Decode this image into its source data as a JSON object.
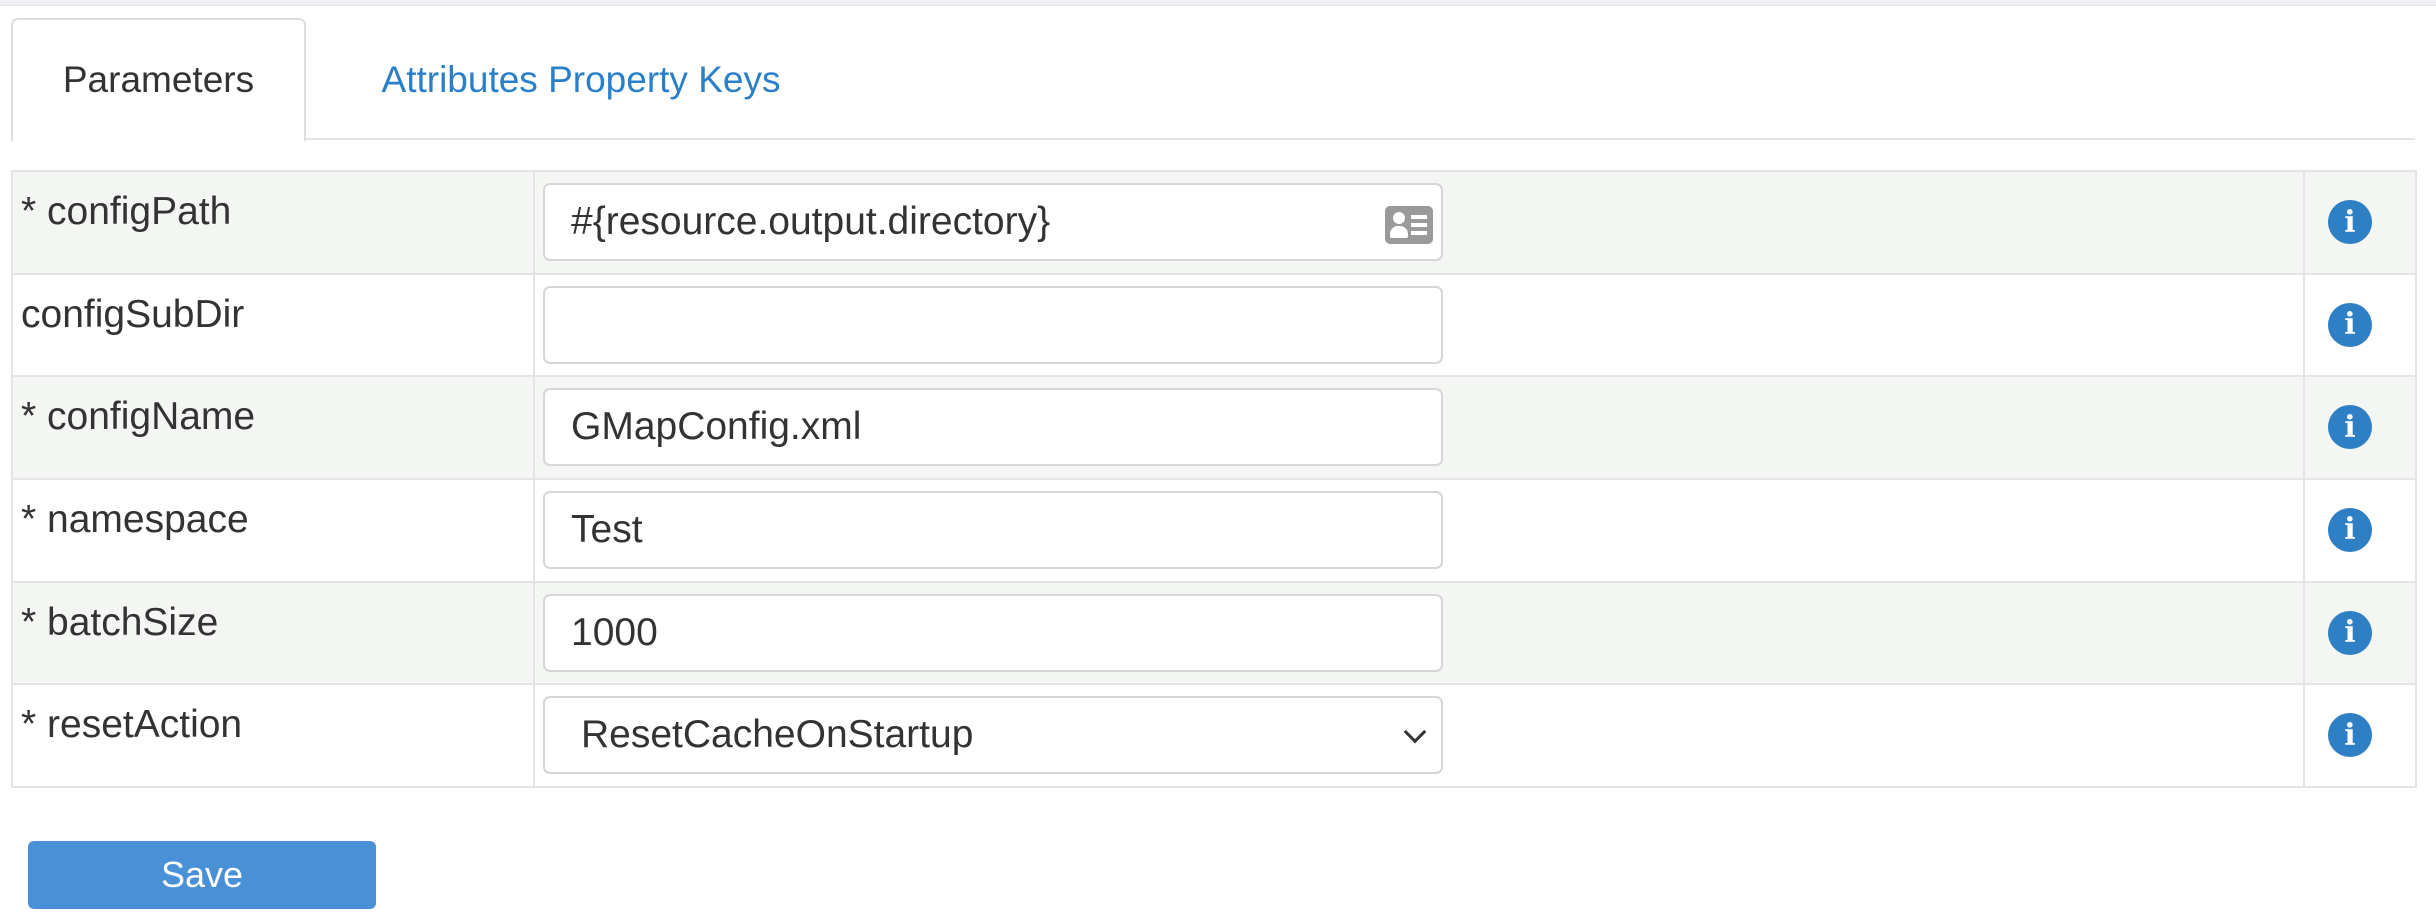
{
  "tabs": [
    {
      "label": "Parameters",
      "active": true
    },
    {
      "label": "Attributes Property Keys",
      "active": false
    }
  ],
  "parameters": [
    {
      "label": "* configPath",
      "value": "#{resource.output.directory}",
      "type": "text",
      "has_picker_icon": true,
      "picker_icon": "address-card-icon"
    },
    {
      "label": "configSubDir",
      "value": "",
      "type": "text"
    },
    {
      "label": "* configName",
      "value": "GMapConfig.xml",
      "type": "text"
    },
    {
      "label": "* namespace",
      "value": "Test",
      "type": "text"
    },
    {
      "label": "* batchSize",
      "value": "1000",
      "type": "text"
    },
    {
      "label": "* resetAction",
      "value": "ResetCacheOnStartup",
      "type": "select"
    }
  ],
  "info_icon": {
    "glyph": "i",
    "icon": "info-circle-icon"
  },
  "actions": {
    "save_label": "Save"
  },
  "colors": {
    "accent": "#2a7fc9",
    "save_button": "#4a90d6",
    "info_icon": "#2f7fc4",
    "alt_row": "#f4f6f3"
  }
}
